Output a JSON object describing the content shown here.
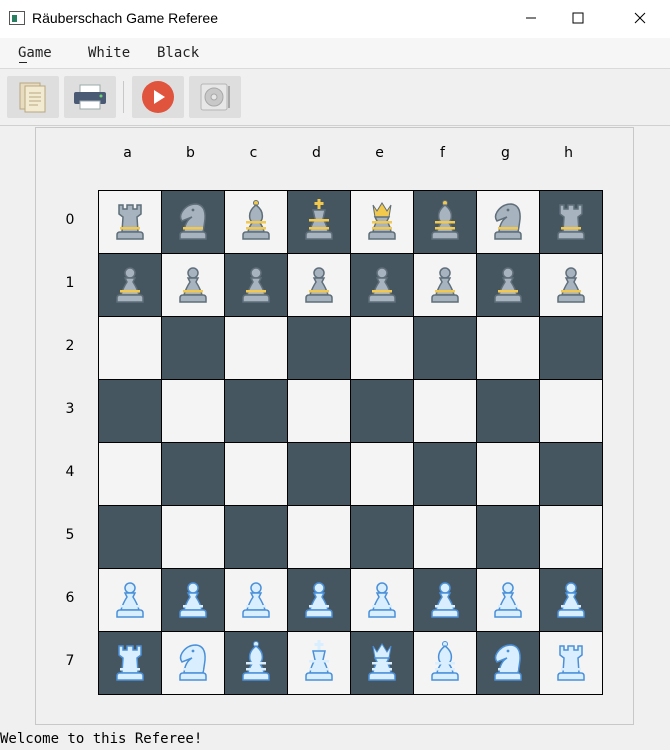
{
  "window": {
    "title": "Räuberschach Game Referee"
  },
  "menu": {
    "items": [
      "Game",
      "White",
      "Black"
    ]
  },
  "toolbar": {
    "buttons": [
      {
        "name": "new-game-button",
        "icon": "document-icon"
      },
      {
        "name": "print-button",
        "icon": "printer-icon"
      },
      {
        "name": "play-button",
        "icon": "play-icon"
      },
      {
        "name": "record-button",
        "icon": "disc-icon"
      }
    ]
  },
  "board": {
    "column_labels": [
      "a",
      "b",
      "c",
      "d",
      "e",
      "f",
      "g",
      "h"
    ],
    "row_labels": [
      "0",
      "1",
      "2",
      "3",
      "4",
      "5",
      "6",
      "7"
    ],
    "square_colors": {
      "light": "#f4f4f4",
      "dark": "#465660"
    },
    "piece_colors": {
      "black": {
        "fill": "#a7b4bf",
        "stroke": "#5f6e7a",
        "band": "#f2c94c"
      },
      "white": {
        "fill": "#d9eeff",
        "stroke": "#4a90d9",
        "band": "#d9eeff"
      }
    },
    "pieces": [
      [
        "black-rook",
        "black-knight",
        "black-bishop",
        "black-king",
        "black-queen",
        "black-bishop",
        "black-knight",
        "black-rook"
      ],
      [
        "black-pawn",
        "black-pawn",
        "black-pawn",
        "black-pawn",
        "black-pawn",
        "black-pawn",
        "black-pawn",
        "black-pawn"
      ],
      [
        "",
        "",
        "",
        "",
        "",
        "",
        "",
        ""
      ],
      [
        "",
        "",
        "",
        "",
        "",
        "",
        "",
        ""
      ],
      [
        "",
        "",
        "",
        "",
        "",
        "",
        "",
        ""
      ],
      [
        "",
        "",
        "",
        "",
        "",
        "",
        "",
        ""
      ],
      [
        "white-pawn",
        "white-pawn",
        "white-pawn",
        "white-pawn",
        "white-pawn",
        "white-pawn",
        "white-pawn",
        "white-pawn"
      ],
      [
        "white-rook",
        "white-knight",
        "white-bishop",
        "white-king",
        "white-queen",
        "white-bishop",
        "white-knight",
        "white-rook"
      ]
    ]
  },
  "status": {
    "message": "Welcome to this Referee!"
  }
}
